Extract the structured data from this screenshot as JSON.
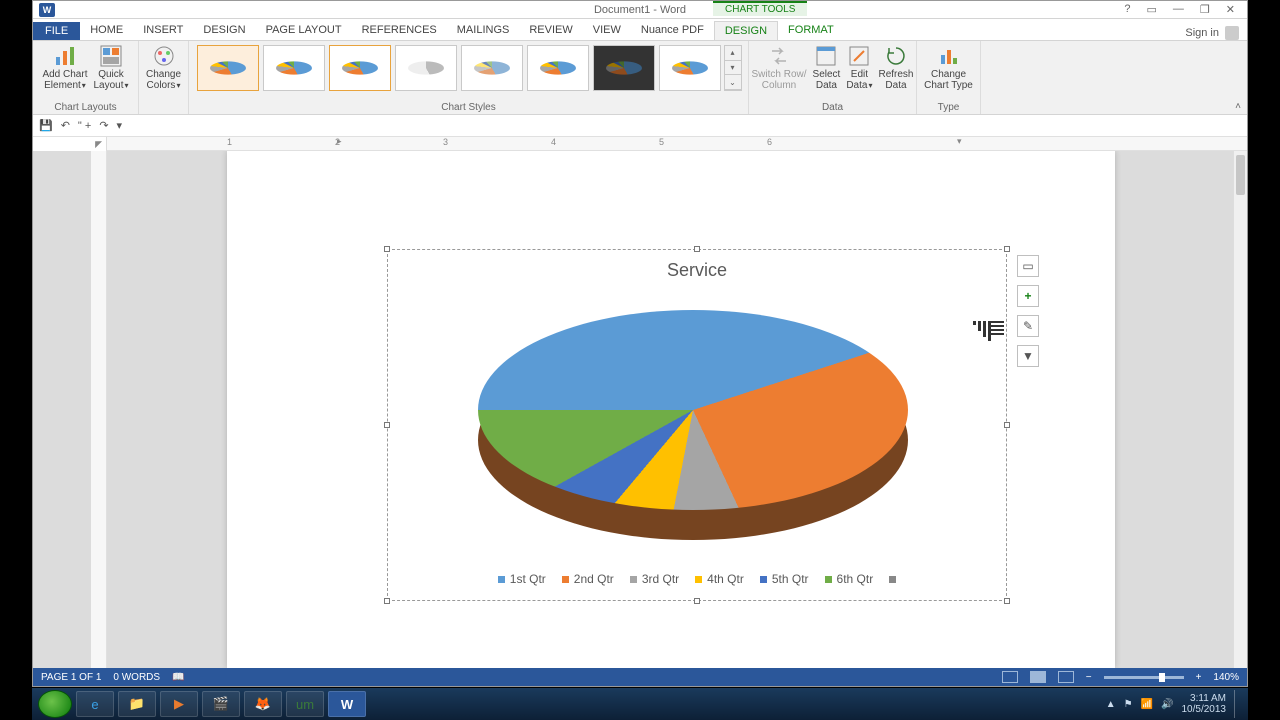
{
  "titlebar": {
    "app_icon_text": "W",
    "title": "Document1 - Word",
    "chart_tools_label": "CHART TOOLS",
    "help_icon": "?",
    "ribbon_opts_icon": "▭",
    "min_icon": "—",
    "restore_icon": "❐",
    "close_icon": "✕"
  },
  "tabs": {
    "file": "FILE",
    "items": [
      "HOME",
      "INSERT",
      "DESIGN",
      "PAGE LAYOUT",
      "REFERENCES",
      "MAILINGS",
      "REVIEW",
      "VIEW",
      "Nuance PDF",
      "DESIGN",
      "FORMAT"
    ],
    "active_index": 9,
    "signin": "Sign in"
  },
  "ribbon": {
    "groups": {
      "chart_layouts": {
        "label": "Chart Layouts",
        "add_element": "Add Chart\nElement",
        "quick_layout": "Quick\nLayout"
      },
      "change_colors": "Change\nColors",
      "chart_styles": {
        "label": "Chart Styles",
        "count": 8,
        "selected": 0,
        "hovered": 2
      },
      "data": {
        "label": "Data",
        "switch": "Switch Row/\nColumn",
        "select": "Select\nData",
        "edit": "Edit\nData",
        "refresh": "Refresh\nData"
      },
      "type": {
        "label": "Type",
        "change": "Change\nChart Type"
      }
    }
  },
  "qat": {
    "save": "💾",
    "undo": "↶",
    "redo": "↷",
    "customize": "▾"
  },
  "ruler": {
    "labels": [
      "1",
      "2",
      "3",
      "4",
      "5",
      "6"
    ]
  },
  "chart": {
    "title": "Service",
    "legend": [
      "1st Qtr",
      "2nd Qtr",
      "3rd Qtr",
      "4th Qtr",
      "5th Qtr",
      "6th Qtr"
    ],
    "colors": [
      "#5b9bd5",
      "#ed7d31",
      "#a5a5a5",
      "#ffc000",
      "#4472c4",
      "#70ad47"
    ]
  },
  "chart_side": {
    "layout_options": "▭",
    "add_element": "+",
    "styles": "✎",
    "filter": "▼"
  },
  "statusbar": {
    "page": "PAGE 1 OF 1",
    "words": "0 WORDS",
    "zoom": "140%",
    "zoom_minus": "−",
    "zoom_plus": "+"
  },
  "taskbar": {
    "apps": [
      {
        "name": "internet-explorer",
        "glyph": "e",
        "color": "#39a0e6"
      },
      {
        "name": "file-explorer",
        "glyph": "📁",
        "color": "#e8c46a"
      },
      {
        "name": "media-player",
        "glyph": "▶",
        "color": "#e87b2f"
      },
      {
        "name": "clapper",
        "glyph": "🎬",
        "color": "#ccc"
      },
      {
        "name": "firefox",
        "glyph": "🦊",
        "color": "#e66a1f"
      },
      {
        "name": "app-um",
        "glyph": "um",
        "color": "#3a7a3a"
      },
      {
        "name": "word",
        "glyph": "W",
        "color": "#2b579a"
      }
    ],
    "active": 6,
    "tray": {
      "up": "▲",
      "flag": "⚑",
      "net": "📶",
      "vol": "🔊"
    },
    "clock": {
      "time": "3:11 AM",
      "date": "10/5/2013"
    }
  },
  "chart_data": {
    "type": "pie",
    "title": "Service",
    "categories": [
      "1st Qtr",
      "2nd Qtr",
      "3rd Qtr",
      "4th Qtr",
      "5th Qtr",
      "6th Qtr"
    ],
    "values": [
      45,
      23,
      10,
      8,
      6,
      8
    ],
    "colors": [
      "#5b9bd5",
      "#ed7d31",
      "#a5a5a5",
      "#ffc000",
      "#4472c4",
      "#70ad47"
    ],
    "legend_position": "bottom",
    "style": "3d"
  }
}
